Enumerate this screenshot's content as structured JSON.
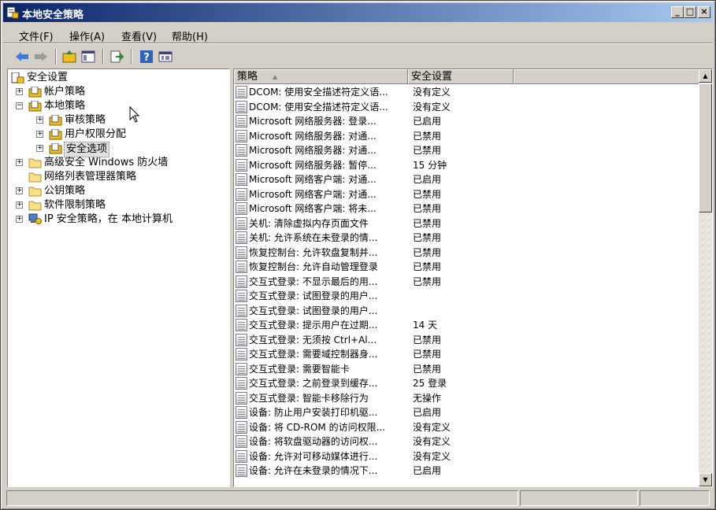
{
  "window": {
    "title": "本地安全策略",
    "controls": {
      "minimize": "_",
      "maximize": "□",
      "close": "×"
    }
  },
  "menu": [
    "文件(F)",
    "操作(A)",
    "查看(V)",
    "帮助(H)"
  ],
  "toolbar": [
    "back-icon",
    "forward-icon",
    "up-folder-icon",
    "show-hide-tree-icon",
    "export-list-icon",
    "help-icon",
    "properties-icon"
  ],
  "tree": [
    {
      "label": "安全设置",
      "level": 0,
      "expander": "",
      "icon": "security-settings-icon"
    },
    {
      "label": "帐户策略",
      "level": 1,
      "expander": "+",
      "icon": "policy-folder-icon"
    },
    {
      "label": "本地策略",
      "level": 1,
      "expander": "−",
      "icon": "policy-folder-icon"
    },
    {
      "label": "审核策略",
      "level": 2,
      "expander": "+",
      "icon": "policy-folder-icon"
    },
    {
      "label": "用户权限分配",
      "level": 2,
      "expander": "+",
      "icon": "policy-folder-icon"
    },
    {
      "label": "安全选项",
      "level": 2,
      "expander": "+",
      "icon": "policy-folder-icon",
      "selected": true
    },
    {
      "label": "高级安全 Windows 防火墙",
      "level": 1,
      "expander": "+",
      "icon": "folder-icon"
    },
    {
      "label": "网络列表管理器策略",
      "level": 1,
      "expander": "",
      "icon": "folder-icon"
    },
    {
      "label": "公钥策略",
      "level": 1,
      "expander": "+",
      "icon": "folder-icon"
    },
    {
      "label": "软件限制策略",
      "level": 1,
      "expander": "+",
      "icon": "folder-icon"
    },
    {
      "label": "IP 安全策略，在 本地计算机",
      "level": 1,
      "expander": "+",
      "icon": "ip-security-icon"
    }
  ],
  "columns": {
    "policy": "策略",
    "sort_indicator": "▲",
    "setting": "安全设置"
  },
  "rows": [
    {
      "name": "DCOM: 使用安全描述符定义语...",
      "setting": "没有定义"
    },
    {
      "name": "DCOM: 使用安全描述符定义语...",
      "setting": "没有定义"
    },
    {
      "name": "Microsoft 网络服务器: 登录...",
      "setting": "已启用"
    },
    {
      "name": "Microsoft 网络服务器: 对通...",
      "setting": "已禁用"
    },
    {
      "name": "Microsoft 网络服务器: 对通...",
      "setting": "已禁用"
    },
    {
      "name": "Microsoft 网络服务器: 暂停...",
      "setting": "15 分钟"
    },
    {
      "name": "Microsoft 网络客户端: 对通...",
      "setting": "已启用"
    },
    {
      "name": "Microsoft 网络客户端: 对通...",
      "setting": "已禁用"
    },
    {
      "name": "Microsoft 网络客户端: 将未...",
      "setting": "已禁用"
    },
    {
      "name": "关机: 清除虚拟内存页面文件",
      "setting": "已禁用"
    },
    {
      "name": "关机: 允许系统在未登录的情...",
      "setting": "已禁用"
    },
    {
      "name": "恢复控制台: 允许软盘复制并...",
      "setting": "已禁用"
    },
    {
      "name": "恢复控制台: 允许自动管理登录",
      "setting": "已禁用"
    },
    {
      "name": "交互式登录: 不显示最后的用...",
      "setting": "已禁用"
    },
    {
      "name": "交互式登录: 试图登录的用户...",
      "setting": ""
    },
    {
      "name": "交互式登录: 试图登录的用户...",
      "setting": ""
    },
    {
      "name": "交互式登录: 提示用户在过期...",
      "setting": "14 天"
    },
    {
      "name": "交互式登录: 无须按 Ctrl+Al...",
      "setting": "已禁用"
    },
    {
      "name": "交互式登录: 需要域控制器身...",
      "setting": "已禁用"
    },
    {
      "name": "交互式登录: 需要智能卡",
      "setting": "已禁用"
    },
    {
      "name": "交互式登录: 之前登录到缓存...",
      "setting": "25 登录"
    },
    {
      "name": "交互式登录: 智能卡移除行为",
      "setting": "无操作"
    },
    {
      "name": "设备: 防止用户安装打印机驱...",
      "setting": "已启用"
    },
    {
      "name": "设备: 将 CD-ROM 的访问权限...",
      "setting": "没有定义"
    },
    {
      "name": "设备: 将软盘驱动器的访问权...",
      "setting": "没有定义"
    },
    {
      "name": "设备: 允许对可移动媒体进行...",
      "setting": "没有定义"
    },
    {
      "name": "设备: 允许在未登录的情况下...",
      "setting": "已启用"
    }
  ]
}
